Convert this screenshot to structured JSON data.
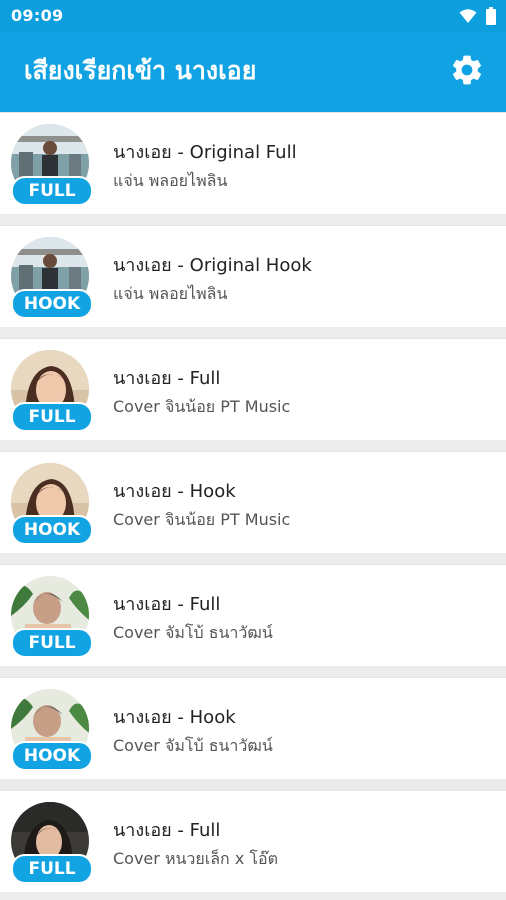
{
  "status_bar": {
    "time": "09:09",
    "icons": [
      "wifi-icon",
      "battery-icon"
    ]
  },
  "app_bar": {
    "title": "เสียงเรียกเข้า นางเอย",
    "settings_icon": "gear-icon"
  },
  "colors": {
    "primary": "#10a2e2",
    "status_bar": "#0d9edd",
    "badge": "#12a3e3",
    "divider": "#ececec"
  },
  "songs": [
    {
      "title": "นางเอย - Original Full",
      "artist": "แจ่น พลอยไพลิน",
      "badge": "FULL",
      "avatar": "singer-male-outdoor"
    },
    {
      "title": "นางเอย - Original Hook",
      "artist": "แจ่น พลอยไพลิน",
      "badge": "HOOK",
      "avatar": "singer-male-outdoor"
    },
    {
      "title": "นางเอย - Full",
      "artist": "Cover จินน้อย PT Music",
      "badge": "FULL",
      "avatar": "singer-female"
    },
    {
      "title": "นางเอย - Hook",
      "artist": "Cover จินน้อย PT Music",
      "badge": "HOOK",
      "avatar": "singer-female"
    },
    {
      "title": "นางเอย - Full",
      "artist": "Cover จัมโบ้ ธนาวัฒน์",
      "badge": "FULL",
      "avatar": "singer-male-plants"
    },
    {
      "title": "นางเอย - Hook",
      "artist": "Cover จัมโบ้ ธนาวัฒน์",
      "badge": "HOOK",
      "avatar": "singer-male-plants"
    },
    {
      "title": "นางเอย - Full",
      "artist": "Cover หนวยเล็ก x โอ๊ต",
      "badge": "FULL",
      "avatar": "singer-female-dark"
    }
  ]
}
